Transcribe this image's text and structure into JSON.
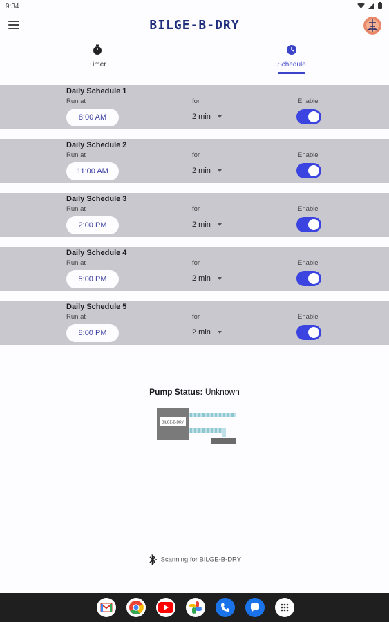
{
  "status_bar": {
    "time": "9:34"
  },
  "app": {
    "title": "BILGE-B-DRY"
  },
  "tabs": [
    {
      "label": "Timer",
      "icon": "stopwatch-icon",
      "active": false
    },
    {
      "label": "Schedule",
      "icon": "clock-icon",
      "active": true
    }
  ],
  "schedule_labels": {
    "run_at": "Run at",
    "for": "for",
    "enable": "Enable"
  },
  "schedules": [
    {
      "title": "Daily Schedule 1",
      "time": "8:00 AM",
      "duration": "2 min",
      "enabled": true
    },
    {
      "title": "Daily Schedule 2",
      "time": "11:00 AM",
      "duration": "2 min",
      "enabled": true
    },
    {
      "title": "Daily Schedule 3",
      "time": "2:00 PM",
      "duration": "2 min",
      "enabled": true
    },
    {
      "title": "Daily Schedule 4",
      "time": "5:00 PM",
      "duration": "2 min",
      "enabled": true
    },
    {
      "title": "Daily Schedule 5",
      "time": "8:00 PM",
      "duration": "2 min",
      "enabled": true
    }
  ],
  "pump": {
    "label": "Pump Status:",
    "value": "Unknown",
    "device_label": "BILGE-B-DRY"
  },
  "scanning": {
    "text": "Scanning for BILGE-B-DRY"
  },
  "dock_apps": [
    "gmail-icon",
    "chrome-icon",
    "youtube-icon",
    "photos-icon",
    "phone-icon",
    "messages-icon",
    "app-drawer-icon"
  ],
  "colors": {
    "accent": "#3b44e0",
    "title": "#1e2e7a",
    "schedule_bg": "#c9c8cf"
  }
}
